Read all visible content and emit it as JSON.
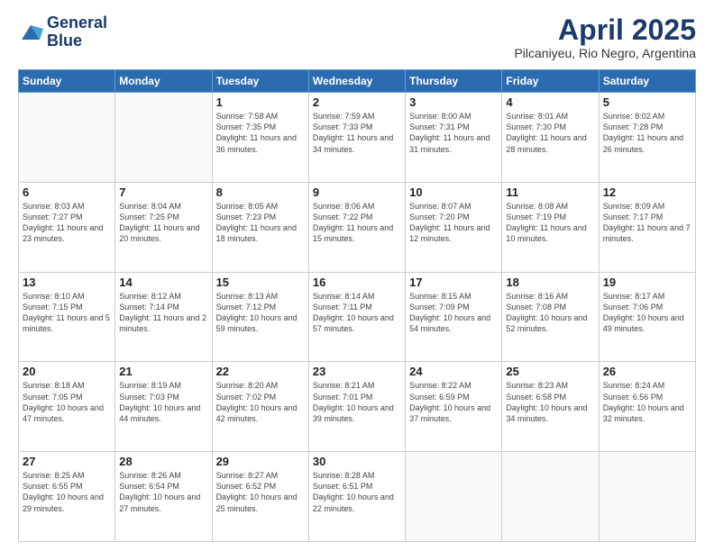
{
  "logo": {
    "line1": "General",
    "line2": "Blue"
  },
  "title": "April 2025",
  "subtitle": "Pilcaniyeu, Rio Negro, Argentina",
  "days_of_week": [
    "Sunday",
    "Monday",
    "Tuesday",
    "Wednesday",
    "Thursday",
    "Friday",
    "Saturday"
  ],
  "weeks": [
    [
      {
        "day": "",
        "sunrise": "",
        "sunset": "",
        "daylight": ""
      },
      {
        "day": "",
        "sunrise": "",
        "sunset": "",
        "daylight": ""
      },
      {
        "day": "1",
        "sunrise": "Sunrise: 7:58 AM",
        "sunset": "Sunset: 7:35 PM",
        "daylight": "Daylight: 11 hours and 36 minutes."
      },
      {
        "day": "2",
        "sunrise": "Sunrise: 7:59 AM",
        "sunset": "Sunset: 7:33 PM",
        "daylight": "Daylight: 11 hours and 34 minutes."
      },
      {
        "day": "3",
        "sunrise": "Sunrise: 8:00 AM",
        "sunset": "Sunset: 7:31 PM",
        "daylight": "Daylight: 11 hours and 31 minutes."
      },
      {
        "day": "4",
        "sunrise": "Sunrise: 8:01 AM",
        "sunset": "Sunset: 7:30 PM",
        "daylight": "Daylight: 11 hours and 28 minutes."
      },
      {
        "day": "5",
        "sunrise": "Sunrise: 8:02 AM",
        "sunset": "Sunset: 7:28 PM",
        "daylight": "Daylight: 11 hours and 26 minutes."
      }
    ],
    [
      {
        "day": "6",
        "sunrise": "Sunrise: 8:03 AM",
        "sunset": "Sunset: 7:27 PM",
        "daylight": "Daylight: 11 hours and 23 minutes."
      },
      {
        "day": "7",
        "sunrise": "Sunrise: 8:04 AM",
        "sunset": "Sunset: 7:25 PM",
        "daylight": "Daylight: 11 hours and 20 minutes."
      },
      {
        "day": "8",
        "sunrise": "Sunrise: 8:05 AM",
        "sunset": "Sunset: 7:23 PM",
        "daylight": "Daylight: 11 hours and 18 minutes."
      },
      {
        "day": "9",
        "sunrise": "Sunrise: 8:06 AM",
        "sunset": "Sunset: 7:22 PM",
        "daylight": "Daylight: 11 hours and 15 minutes."
      },
      {
        "day": "10",
        "sunrise": "Sunrise: 8:07 AM",
        "sunset": "Sunset: 7:20 PM",
        "daylight": "Daylight: 11 hours and 12 minutes."
      },
      {
        "day": "11",
        "sunrise": "Sunrise: 8:08 AM",
        "sunset": "Sunset: 7:19 PM",
        "daylight": "Daylight: 11 hours and 10 minutes."
      },
      {
        "day": "12",
        "sunrise": "Sunrise: 8:09 AM",
        "sunset": "Sunset: 7:17 PM",
        "daylight": "Daylight: 11 hours and 7 minutes."
      }
    ],
    [
      {
        "day": "13",
        "sunrise": "Sunrise: 8:10 AM",
        "sunset": "Sunset: 7:15 PM",
        "daylight": "Daylight: 11 hours and 5 minutes."
      },
      {
        "day": "14",
        "sunrise": "Sunrise: 8:12 AM",
        "sunset": "Sunset: 7:14 PM",
        "daylight": "Daylight: 11 hours and 2 minutes."
      },
      {
        "day": "15",
        "sunrise": "Sunrise: 8:13 AM",
        "sunset": "Sunset: 7:12 PM",
        "daylight": "Daylight: 10 hours and 59 minutes."
      },
      {
        "day": "16",
        "sunrise": "Sunrise: 8:14 AM",
        "sunset": "Sunset: 7:11 PM",
        "daylight": "Daylight: 10 hours and 57 minutes."
      },
      {
        "day": "17",
        "sunrise": "Sunrise: 8:15 AM",
        "sunset": "Sunset: 7:09 PM",
        "daylight": "Daylight: 10 hours and 54 minutes."
      },
      {
        "day": "18",
        "sunrise": "Sunrise: 8:16 AM",
        "sunset": "Sunset: 7:08 PM",
        "daylight": "Daylight: 10 hours and 52 minutes."
      },
      {
        "day": "19",
        "sunrise": "Sunrise: 8:17 AM",
        "sunset": "Sunset: 7:06 PM",
        "daylight": "Daylight: 10 hours and 49 minutes."
      }
    ],
    [
      {
        "day": "20",
        "sunrise": "Sunrise: 8:18 AM",
        "sunset": "Sunset: 7:05 PM",
        "daylight": "Daylight: 10 hours and 47 minutes."
      },
      {
        "day": "21",
        "sunrise": "Sunrise: 8:19 AM",
        "sunset": "Sunset: 7:03 PM",
        "daylight": "Daylight: 10 hours and 44 minutes."
      },
      {
        "day": "22",
        "sunrise": "Sunrise: 8:20 AM",
        "sunset": "Sunset: 7:02 PM",
        "daylight": "Daylight: 10 hours and 42 minutes."
      },
      {
        "day": "23",
        "sunrise": "Sunrise: 8:21 AM",
        "sunset": "Sunset: 7:01 PM",
        "daylight": "Daylight: 10 hours and 39 minutes."
      },
      {
        "day": "24",
        "sunrise": "Sunrise: 8:22 AM",
        "sunset": "Sunset: 6:59 PM",
        "daylight": "Daylight: 10 hours and 37 minutes."
      },
      {
        "day": "25",
        "sunrise": "Sunrise: 8:23 AM",
        "sunset": "Sunset: 6:58 PM",
        "daylight": "Daylight: 10 hours and 34 minutes."
      },
      {
        "day": "26",
        "sunrise": "Sunrise: 8:24 AM",
        "sunset": "Sunset: 6:56 PM",
        "daylight": "Daylight: 10 hours and 32 minutes."
      }
    ],
    [
      {
        "day": "27",
        "sunrise": "Sunrise: 8:25 AM",
        "sunset": "Sunset: 6:55 PM",
        "daylight": "Daylight: 10 hours and 29 minutes."
      },
      {
        "day": "28",
        "sunrise": "Sunrise: 8:26 AM",
        "sunset": "Sunset: 6:54 PM",
        "daylight": "Daylight: 10 hours and 27 minutes."
      },
      {
        "day": "29",
        "sunrise": "Sunrise: 8:27 AM",
        "sunset": "Sunset: 6:52 PM",
        "daylight": "Daylight: 10 hours and 25 minutes."
      },
      {
        "day": "30",
        "sunrise": "Sunrise: 8:28 AM",
        "sunset": "Sunset: 6:51 PM",
        "daylight": "Daylight: 10 hours and 22 minutes."
      },
      {
        "day": "",
        "sunrise": "",
        "sunset": "",
        "daylight": ""
      },
      {
        "day": "",
        "sunrise": "",
        "sunset": "",
        "daylight": ""
      },
      {
        "day": "",
        "sunrise": "",
        "sunset": "",
        "daylight": ""
      }
    ]
  ]
}
